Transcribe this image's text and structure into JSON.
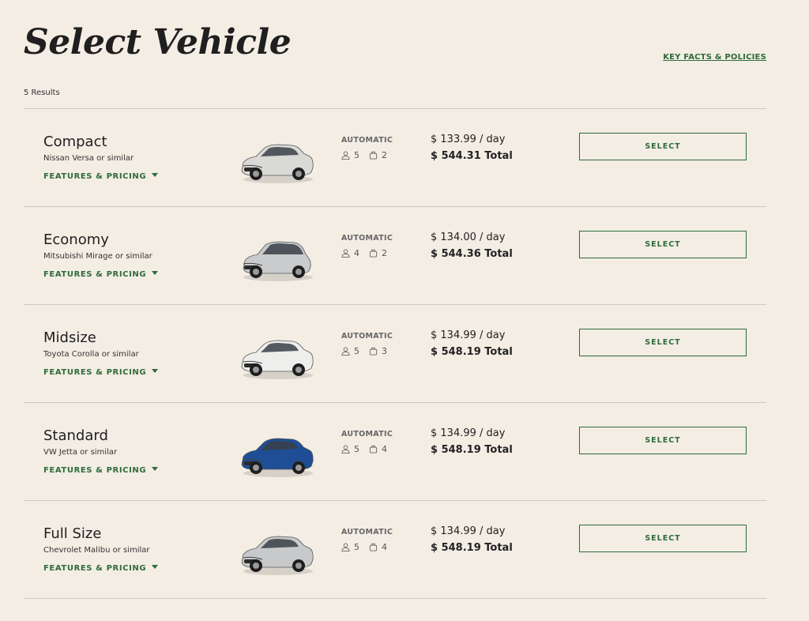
{
  "header": {
    "title": "Select Vehicle",
    "key_facts_link": "KEY FACTS & POLICIES",
    "results_count": "5 Results"
  },
  "colors": {
    "background": "#f3ede4",
    "accent_green": "#2e6b3a",
    "divider": "#cfc8be"
  },
  "vehicles": [
    {
      "class_name": "Compact",
      "model": "Nissan Versa or similar",
      "features_label": "FEATURES & PRICING",
      "transmission": "AUTOMATIC",
      "passengers": "5",
      "bags": "2",
      "rate": "$ 133.99 / day",
      "total": "$ 544.31 Total",
      "select_label": "SELECT",
      "car_color": "#d9d9d6",
      "car_shape": "sedan"
    },
    {
      "class_name": "Economy",
      "model": "Mitsubishi Mirage or similar",
      "features_label": "FEATURES & PRICING",
      "transmission": "AUTOMATIC",
      "passengers": "4",
      "bags": "2",
      "rate": "$ 134.00 / day",
      "total": "$ 544.36 Total",
      "select_label": "SELECT",
      "car_color": "#c9cbcc",
      "car_shape": "hatchback"
    },
    {
      "class_name": "Midsize",
      "model": "Toyota Corolla or similar",
      "features_label": "FEATURES & PRICING",
      "transmission": "AUTOMATIC",
      "passengers": "5",
      "bags": "3",
      "rate": "$ 134.99 / day",
      "total": "$ 548.19 Total",
      "select_label": "SELECT",
      "car_color": "#eeeeec",
      "car_shape": "sedan"
    },
    {
      "class_name": "Standard",
      "model": "VW Jetta or similar",
      "features_label": "FEATURES & PRICING",
      "transmission": "AUTOMATIC",
      "passengers": "5",
      "bags": "4",
      "rate": "$ 134.99 / day",
      "total": "$ 548.19 Total",
      "select_label": "SELECT",
      "car_color": "#1f4e96",
      "car_shape": "sedan"
    },
    {
      "class_name": "Full Size",
      "model": "Chevrolet Malibu or similar",
      "features_label": "FEATURES & PRICING",
      "transmission": "AUTOMATIC",
      "passengers": "5",
      "bags": "4",
      "rate": "$ 134.99 / day",
      "total": "$ 548.19 Total",
      "select_label": "SELECT",
      "car_color": "#c8c9ca",
      "car_shape": "sedan"
    }
  ]
}
